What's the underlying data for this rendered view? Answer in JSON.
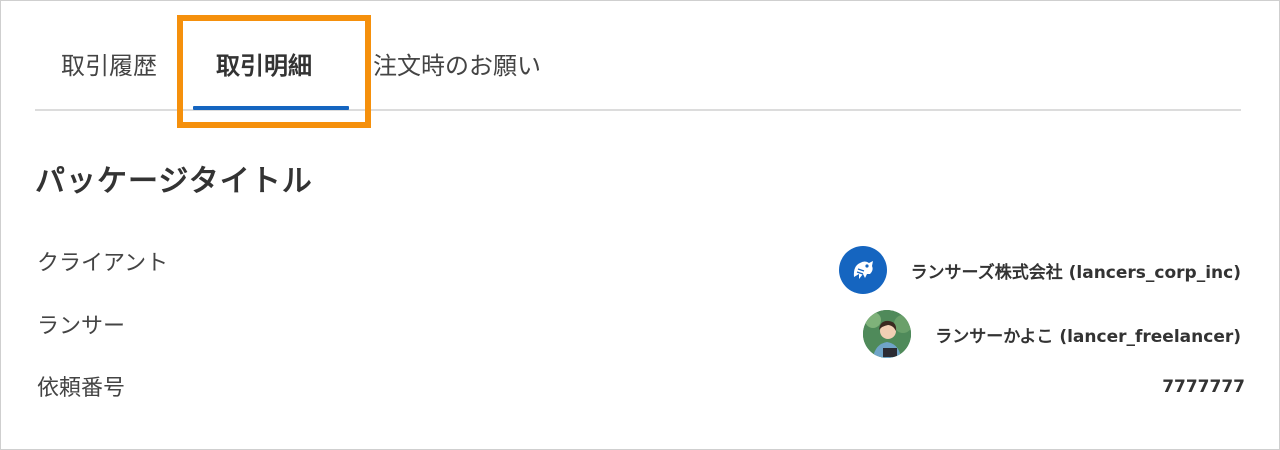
{
  "tabs": [
    {
      "label": "取引履歴",
      "active": false
    },
    {
      "label": "取引明細",
      "active": true
    },
    {
      "label": "注文時のお願い",
      "active": false
    }
  ],
  "colors": {
    "accent": "#1565c0",
    "highlight": "#f5900c",
    "divider": "#dcdcdc"
  },
  "package": {
    "title": "パッケージタイトル"
  },
  "details": {
    "client_label": "クライアント",
    "client_name": "ランサーズ株式会社 (lancers_corp_inc)",
    "client_avatar_icon": "lancers-logo-icon",
    "lancer_label": "ランサー",
    "lancer_name": "ランサーかよこ (lancer_freelancer)",
    "lancer_avatar_icon": "user-photo-avatar",
    "request_number_label": "依頼番号",
    "request_number": "7777777"
  }
}
